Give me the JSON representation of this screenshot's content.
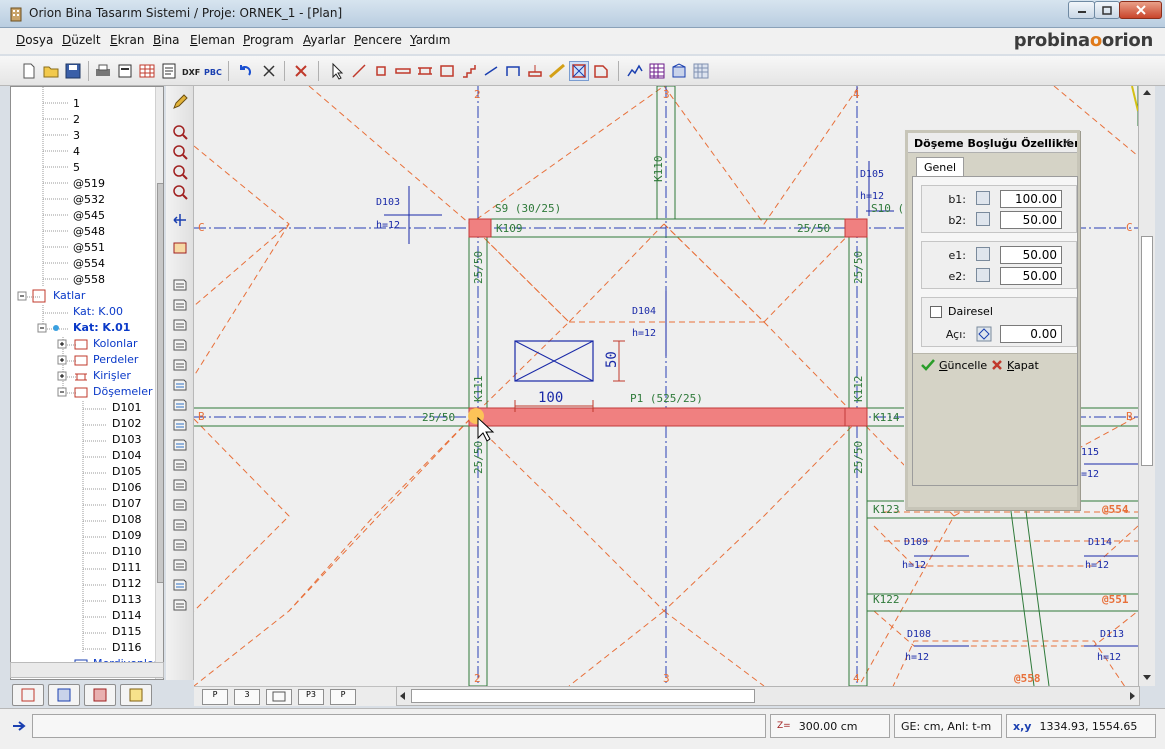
{
  "window": {
    "title": "Orion Bina Tasarım Sistemi / Proje: ORNEK_1 - [Plan]"
  },
  "brand": {
    "left": "probina",
    "dot": "o",
    "right": "orion"
  },
  "menu": [
    "Dosya",
    "Düzelt",
    "Ekran",
    "Bina",
    "Eleman",
    "Program",
    "Ayarlar",
    "Pencere",
    "Yardım"
  ],
  "tree": {
    "rows": [
      {
        "label": "1",
        "style": ""
      },
      {
        "label": "2",
        "style": ""
      },
      {
        "label": "3",
        "style": ""
      },
      {
        "label": "4",
        "style": ""
      },
      {
        "label": "5",
        "style": ""
      },
      {
        "label": "@519",
        "style": ""
      },
      {
        "label": "@532",
        "style": ""
      },
      {
        "label": "@545",
        "style": ""
      },
      {
        "label": "@548",
        "style": ""
      },
      {
        "label": "@551",
        "style": ""
      },
      {
        "label": "@554",
        "style": ""
      },
      {
        "label": "@558",
        "style": ""
      },
      {
        "label": "Katlar",
        "style": "blue"
      },
      {
        "label": "Kat: K.00",
        "style": "blue"
      },
      {
        "label": "Kat: K.01",
        "style": "bold"
      },
      {
        "label": "Kolonlar",
        "style": "blue"
      },
      {
        "label": "Perdeler",
        "style": "blue"
      },
      {
        "label": "Kirişler",
        "style": "blue"
      },
      {
        "label": "Döşemeler",
        "style": "blue"
      },
      {
        "label": "D101",
        "style": ""
      },
      {
        "label": "D102",
        "style": ""
      },
      {
        "label": "D103",
        "style": ""
      },
      {
        "label": "D104",
        "style": ""
      },
      {
        "label": "D105",
        "style": ""
      },
      {
        "label": "D106",
        "style": ""
      },
      {
        "label": "D107",
        "style": ""
      },
      {
        "label": "D108",
        "style": ""
      },
      {
        "label": "D109",
        "style": ""
      },
      {
        "label": "D110",
        "style": ""
      },
      {
        "label": "D111",
        "style": ""
      },
      {
        "label": "D112",
        "style": ""
      },
      {
        "label": "D113",
        "style": ""
      },
      {
        "label": "D114",
        "style": ""
      },
      {
        "label": "D115",
        "style": ""
      },
      {
        "label": "D116",
        "style": ""
      },
      {
        "label": "Merdivenler",
        "style": "blue"
      }
    ]
  },
  "bottom_tabs": [
    "P",
    "3",
    "",
    "P3",
    "P"
  ],
  "plan": {
    "axis_labels": [
      "2",
      "3",
      "4",
      "C",
      "B",
      "2",
      "3",
      "4",
      "C",
      "B"
    ],
    "beams": [
      "K109",
      "K110",
      "K111",
      "K112",
      "K114",
      "K123",
      "K122"
    ],
    "beam_sizes": [
      "25/50",
      "25/50",
      "25/50",
      "25/50",
      "25/50",
      "25/50"
    ],
    "columns": [
      "S9 (30/25)",
      "S10 (",
      "P1 (525/25)"
    ],
    "slabs": [
      {
        "name": "D103",
        "h": "h=12"
      },
      {
        "name": "D104",
        "h": "h=12"
      },
      {
        "name": "D105",
        "h": "h=12"
      },
      {
        "name": "D109",
        "h": "h=12"
      },
      {
        "name": "D114",
        "h": "h=12"
      },
      {
        "name": "D108",
        "h": "h=12"
      },
      {
        "name": "D113",
        "h": "h=12"
      },
      {
        "name": "115",
        "h": "=12"
      }
    ],
    "nodes": [
      "@554",
      "@551",
      "@558"
    ],
    "opening": {
      "width_label": "100",
      "height_label": "50"
    }
  },
  "dialog": {
    "title": "Döşeme Boşluğu Özellikleri",
    "close": "✕",
    "tab": "Genel",
    "b1_label": "b1:",
    "b1": "100.00",
    "b2_label": "b2:",
    "b2": "50.00",
    "e1_label": "e1:",
    "e1": "50.00",
    "e2_label": "e2:",
    "e2": "50.00",
    "circular_label": "Dairesel",
    "angle_label": "Açı:",
    "angle": "0.00",
    "update_label": "Güncelle",
    "close_label": "Kapat"
  },
  "status": {
    "z_label": "Z=",
    "z_value": "300.00 cm",
    "units": "GE: cm,  Anl: t-m",
    "xy_label": "x,y",
    "xy_value": "1334.93, 1554.65"
  },
  "colors": {
    "grid_orange": "#e8703a",
    "axis_blue": "#2a3fb5",
    "beam_green": "#2f7a3a",
    "highlight_red": "#f08080",
    "dim_blue": "#1a2aa8"
  }
}
